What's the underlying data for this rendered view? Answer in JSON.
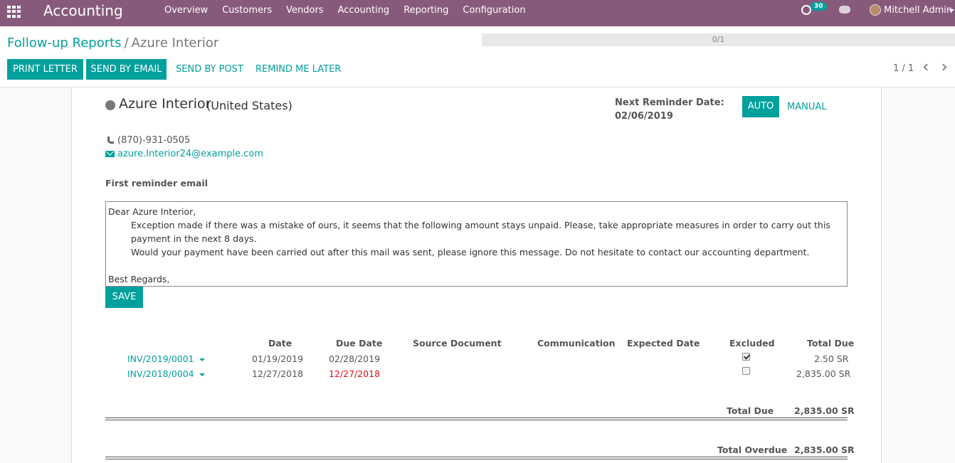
{
  "navbar": {
    "brand": "Accounting",
    "menu": [
      "Overview",
      "Customers",
      "Vendors",
      "Accounting",
      "Reporting",
      "Configuration"
    ],
    "activity_count": "30",
    "user_name": "Mitchell Admin"
  },
  "breadcrumb": {
    "parent": "Follow-up Reports",
    "separator": "/",
    "current": "Azure Interior"
  },
  "progress": {
    "label": "0/1",
    "value": 0
  },
  "actions": {
    "print_letter": "PRINT LETTER",
    "send_by_email": "SEND BY EMAIL",
    "send_by_post": "SEND BY POST",
    "remind_me_later": "REMIND ME LATER"
  },
  "pager": {
    "label": "1 / 1"
  },
  "partner": {
    "name": "Azure Interior",
    "country": "(United States)",
    "phone": "(870)-931-0505",
    "email": "azure.Interior24@example.com"
  },
  "reminder": {
    "next_label": "Next Reminder Date:",
    "next_date": "02/06/2019",
    "auto_label": "AUTO",
    "manual_label": "MANUAL"
  },
  "email_section": {
    "title": "First reminder email",
    "greeting": "Dear Azure Interior,",
    "line1": "Exception made if there was a mistake of ours, it seems that the following amount stays unpaid. Please, take appropriate measures in order to carry out this payment in the next 8 days.",
    "line2": "Would your payment have been carried out after this mail was sent, please ignore this message. Do not hesitate to contact our accounting department.",
    "closing": "Best Regards,",
    "save_label": "SAVE"
  },
  "table": {
    "headers": {
      "date": "Date",
      "due_date": "Due Date",
      "source_document": "Source Document",
      "communication": "Communication",
      "expected_date": "Expected Date",
      "excluded": "Excluded",
      "total_due": "Total Due"
    },
    "rows": [
      {
        "invoice": "INV/2019/0001",
        "date": "01/19/2019",
        "due_date": "02/28/2019",
        "excluded": true,
        "total_due": "2.50 SR",
        "overdue": false
      },
      {
        "invoice": "INV/2018/0004",
        "date": "12/27/2018",
        "due_date": "12/27/2018",
        "excluded": false,
        "total_due": "2,835.00 SR",
        "overdue": true
      }
    ],
    "total_due_label": "Total Due",
    "total_due_value": "2,835.00 SR",
    "total_overdue_label": "Total Overdue",
    "total_overdue_value": "2,835.00 SR"
  },
  "colors": {
    "navbar": "#875a7b",
    "primary": "#00a09d",
    "overdue": "#d9101e"
  }
}
